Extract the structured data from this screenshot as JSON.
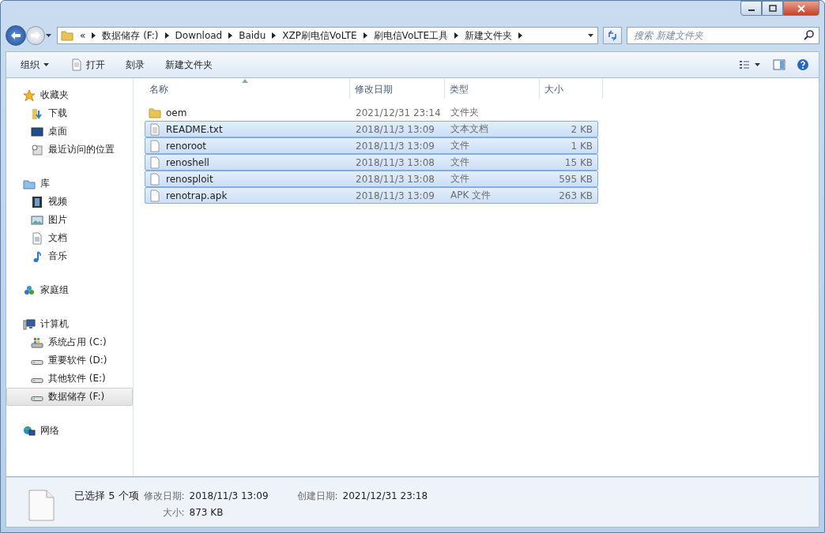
{
  "address": {
    "overflow_mark": "«",
    "crumbs": [
      "数据储存 (F:)",
      "Download",
      "Baidu",
      "XZP刷电信VoLTE",
      "刷电信VoLTE工具",
      "新建文件夹"
    ]
  },
  "search": {
    "placeholder": "搜索 新建文件夹"
  },
  "toolbar": {
    "items": [
      {
        "label": "组织",
        "kind": "menu"
      },
      {
        "label": "打开",
        "kind": "icon"
      },
      {
        "label": "刻录",
        "kind": "plain"
      },
      {
        "label": "新建文件夹",
        "kind": "plain"
      }
    ]
  },
  "sidebar": {
    "groups": [
      {
        "label": "收藏夹",
        "kind": "star",
        "children": [
          {
            "label": "下载",
            "kind": "download",
            "selected": false
          },
          {
            "label": "桌面",
            "kind": "desktop",
            "selected": false
          },
          {
            "label": "最近访问的位置",
            "kind": "recent",
            "selected": false
          }
        ]
      },
      {
        "label": "库",
        "kind": "library",
        "children": [
          {
            "label": "视频",
            "kind": "video",
            "selected": false
          },
          {
            "label": "图片",
            "kind": "picture",
            "selected": false
          },
          {
            "label": "文档",
            "kind": "document",
            "selected": false
          },
          {
            "label": "音乐",
            "kind": "music",
            "selected": false
          }
        ]
      },
      {
        "label": "家庭组",
        "kind": "homegroup"
      },
      {
        "label": "计算机",
        "kind": "computer",
        "children": [
          {
            "label": "系统占用 (C:)",
            "kind": "system-drive",
            "selected": false
          },
          {
            "label": "重要软件 (D:)",
            "kind": "drive",
            "selected": false
          },
          {
            "label": "其他软件 (E:)",
            "kind": "drive",
            "selected": false
          },
          {
            "label": "数据储存 (F:)",
            "kind": "drive",
            "selected": true
          }
        ]
      },
      {
        "label": "网络",
        "kind": "network"
      }
    ]
  },
  "table": {
    "columns": [
      "名称",
      "修改日期",
      "类型",
      "大小"
    ],
    "rows": [
      {
        "name": "oem",
        "date": "2021/12/31 23:14",
        "type": "文件夹",
        "kind": "folder",
        "selected": false
      },
      {
        "name": "README.txt",
        "date": "2018/11/3 13:09",
        "type": "文本文档",
        "size": "2 KB",
        "kind": "text",
        "selected": true
      },
      {
        "name": "renoroot",
        "date": "2018/11/3 13:09",
        "type": "文件",
        "size": "1 KB",
        "kind": "file",
        "selected": true
      },
      {
        "name": "renoshell",
        "date": "2018/11/3 13:08",
        "type": "文件",
        "size": "15 KB",
        "kind": "file",
        "selected": true
      },
      {
        "name": "renosploit",
        "date": "2018/11/3 13:08",
        "type": "文件",
        "size": "595 KB",
        "kind": "file",
        "selected": true
      },
      {
        "name": "renotrap.apk",
        "date": "2018/11/3 13:09",
        "type": "APK 文件",
        "size": "263 KB",
        "kind": "file",
        "selected": true
      }
    ]
  },
  "details": {
    "summary": "已选择 5 个项",
    "fields": [
      {
        "label": "修改日期:",
        "value": "2018/11/3 13:09"
      },
      {
        "label": "大小:",
        "value": "873 KB"
      },
      {
        "label": "创建日期:",
        "value": "2021/12/31 23:18"
      }
    ]
  }
}
